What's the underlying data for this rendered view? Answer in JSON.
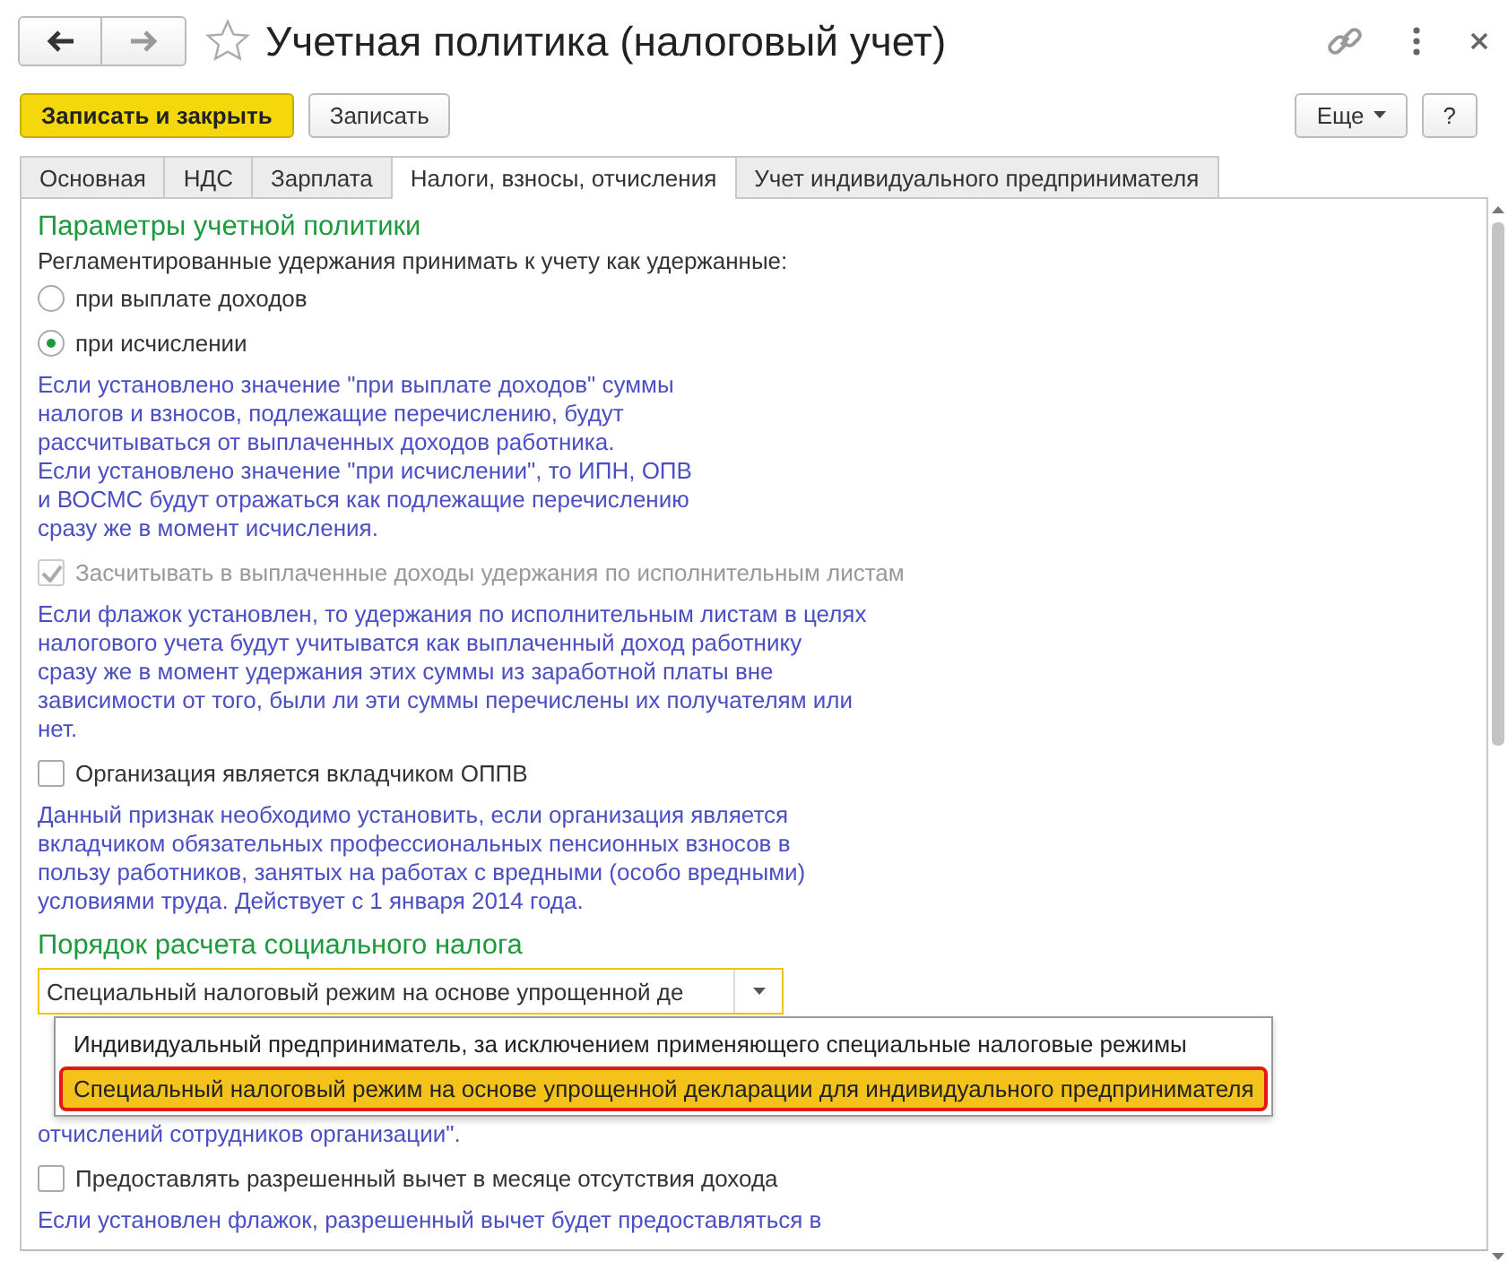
{
  "window": {
    "title": "Учетная политика (налоговый учет)",
    "favorite": false
  },
  "toolbar": {
    "buttons": [
      {
        "label": "Записать и закрыть",
        "kind": "primary"
      },
      {
        "label": "Записать",
        "kind": "normal"
      },
      {
        "label": "Еще",
        "kind": "menu"
      },
      {
        "label": "?",
        "kind": "normal"
      }
    ]
  },
  "tabs": [
    {
      "label": "Основная",
      "selected": false
    },
    {
      "label": "НДС",
      "selected": false
    },
    {
      "label": "Зарплата",
      "selected": false
    },
    {
      "label": "Налоги, взносы, отчисления",
      "selected": true
    },
    {
      "label": "Учет индивидуального предпринимателя",
      "selected": false
    }
  ],
  "sections": [
    {
      "title": "Параметры учетной политики",
      "items": [
        {
          "kind": "label",
          "text": "Регламентированные удержания принимать к учету как удержанные:"
        },
        {
          "kind": "radio",
          "label": "при выплате доходов",
          "selected": false
        },
        {
          "kind": "radio",
          "label": "при исчислении",
          "selected": true
        },
        {
          "kind": "hint",
          "text": "Если установлено значение \"при выплате доходов\" суммы\nналогов и взносов, подлежащие перечислению, будут\nрассчитываться от выплаченных доходов работника.\nЕсли установлено значение \"при исчислении\", то ИПН, ОПВ\nи ВОСМС будут отражаться как подлежащие перечислению\nсразу же в момент исчисления."
        },
        {
          "kind": "checkbox",
          "label": "Засчитывать в выплаченные доходы удержания по исполнительным листам",
          "checked": true,
          "disabled": true
        },
        {
          "kind": "hint",
          "text": "Если флажок установлен, то удержания по исполнительным листам в целях\nналогового учета будут учитыватся как выплаченный доход работнику\nсразу же в момент удержания этих суммы из заработной платы вне\nзависимости от того, были ли эти суммы перечислены их получателям или\nнет."
        },
        {
          "kind": "checkbox",
          "label": "Организация является вкладчиком ОППВ",
          "checked": false,
          "disabled": false
        },
        {
          "kind": "hint",
          "text": "Данный признак необходимо установить, если организация является\nвкладчиком обязательных профессиональных пенсионных взносов в\nпользу работников, занятых на работах с вредными (особо вредными)\nусловиями труда. Действует с 1 января 2014 года."
        }
      ]
    },
    {
      "title": "Порядок расчета социального налога",
      "items": [
        {
          "kind": "select",
          "value": "Специальный налоговый режим на основе упрощенной де",
          "options": [
            {
              "label": "Индивидуальный предприниматель, за исключением применяющего специальные налоговые режимы",
              "selected": false
            },
            {
              "label": "Специальный налоговый режим на основе упрощенной декларации для индивидуального предпринимателя",
              "selected": true
            }
          ]
        },
        {
          "kind": "hint",
          "text": "отчислений сотрудников организации\"."
        },
        {
          "kind": "checkbox",
          "label": "Предоставлять разрешенный вычет в месяце отсутствия дохода",
          "checked": false,
          "disabled": false
        },
        {
          "kind": "hint",
          "text": "Если установлен флажок, разрешенный вычет будет предоставляться в"
        }
      ]
    }
  ]
}
